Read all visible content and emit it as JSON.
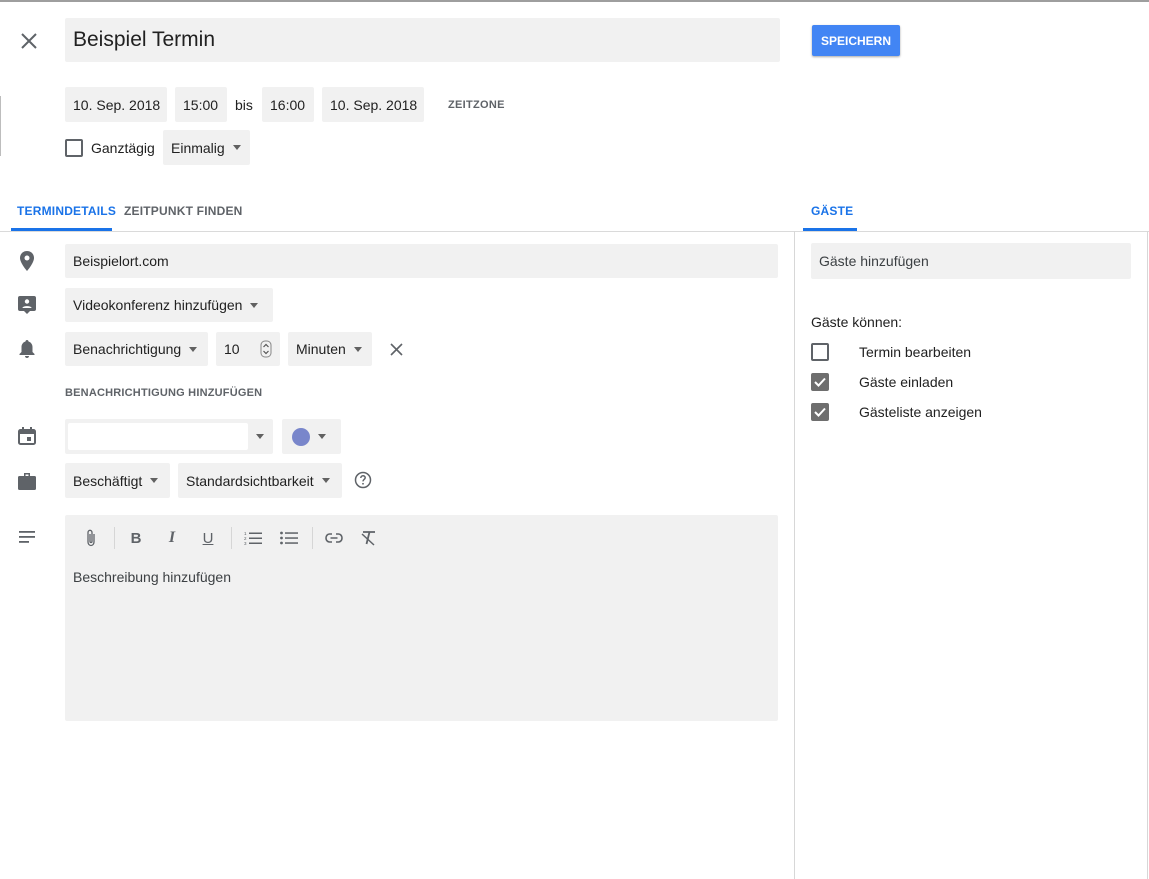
{
  "header": {
    "close_icon": "close-icon",
    "title": "Beispiel Termin",
    "save_label": "SPEICHERN",
    "save_color": "#4285f4"
  },
  "datetime": {
    "start_date": "10. Sep. 2018",
    "start_time": "15:00",
    "separator": "bis",
    "end_time": "16:00",
    "end_date": "10. Sep. 2018",
    "timezone_label": "ZEITZONE",
    "all_day_label": "Ganztägig",
    "all_day_checked": false,
    "repeat_value": "Einmalig"
  },
  "tabs": {
    "details": "TERMINDETAILS",
    "find_time": "ZEITPUNKT FINDEN",
    "guests": "GÄSTE",
    "active_color": "#1a73e8"
  },
  "details": {
    "location_value": "Beispielort.com",
    "conference_label": "Videokonferenz hinzufügen",
    "notification_type": "Benachrichtigung",
    "notification_amount": "10",
    "notification_unit": "Minuten",
    "add_notification_label": "BENACHRICHTIGUNG HINZUFÜGEN",
    "calendar_value": "",
    "event_color": "#7986cb",
    "availability_value": "Beschäftigt",
    "visibility_value": "Standardsichtbarkeit",
    "description_placeholder": "Beschreibung hinzufügen",
    "toolbar": {
      "bold": "B",
      "italic": "I",
      "underline": "U"
    }
  },
  "guests": {
    "add_placeholder": "Gäste hinzufügen",
    "permissions_heading": "Gäste können:",
    "permissions": [
      {
        "label": "Termin bearbeiten",
        "checked": false
      },
      {
        "label": "Gäste einladen",
        "checked": true
      },
      {
        "label": "Gästeliste anzeigen",
        "checked": true
      }
    ]
  }
}
